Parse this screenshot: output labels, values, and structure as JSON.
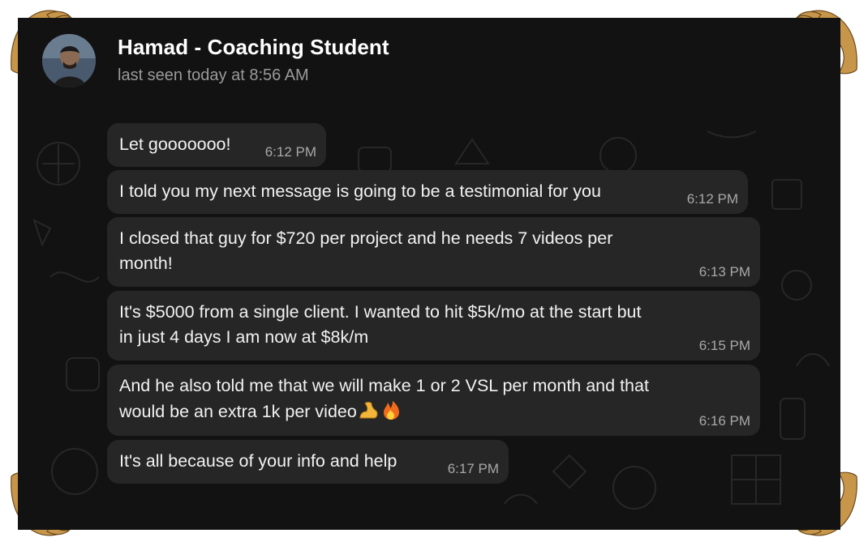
{
  "chat": {
    "title": "Hamad - Coaching Student",
    "status": "last seen today at 8:56 AM"
  },
  "messages": [
    {
      "text": "Let gooooooo!",
      "time": "6:12 PM"
    },
    {
      "text": "I told you my next message is going to be a testimonial for you",
      "time": "6:12 PM"
    },
    {
      "text": "I closed that guy for $720 per project and he needs 7 videos per\nmonth!",
      "time": "6:13 PM"
    },
    {
      "text": "It's $5000 from a single client. I wanted to hit $5k/mo at the start but\nin just 4 days I am now at $8k/m",
      "time": "6:15 PM"
    },
    {
      "text": "And he also told me that we will make 1 or 2 VSL per month and that\nwould be an extra 1k per video",
      "time": "6:16 PM",
      "emoji": [
        "flexed-biceps",
        "fire"
      ]
    },
    {
      "text": "It's all because of your info and help",
      "time": "6:17 PM"
    }
  ],
  "colors": {
    "background": "#121212",
    "bubble": "#262626",
    "ornament": "#c8964a"
  }
}
